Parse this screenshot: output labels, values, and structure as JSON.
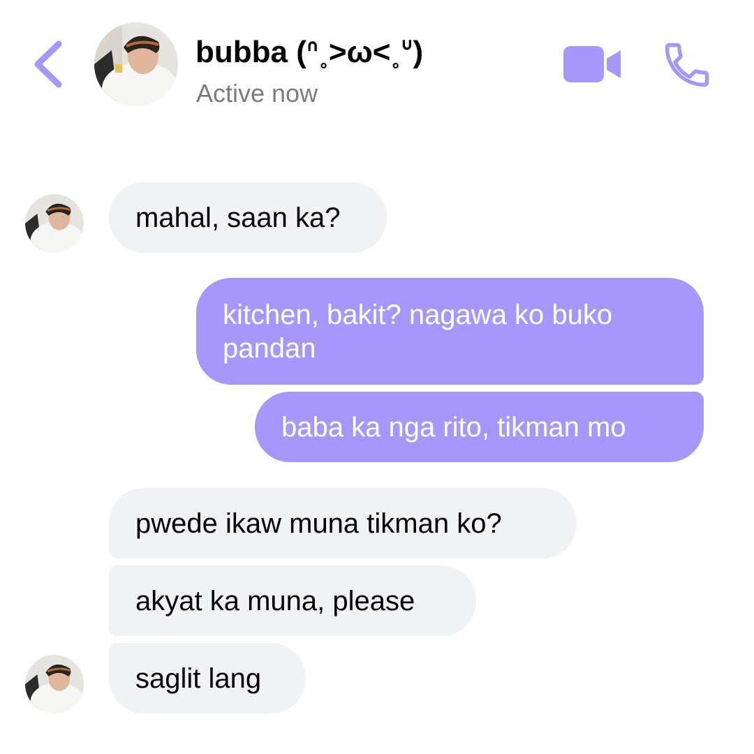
{
  "theme": {
    "accent": "#a797fd",
    "incoming_bubble": "#f1f2f6",
    "outgoing_bubble": "#a797fd",
    "status_gray": "#7a7a80"
  },
  "header": {
    "back_icon": "chevron-left-icon",
    "contact_name": "bubba (ᐢ˳>ω<˳ᐡ)",
    "status": "Active now",
    "video_icon": "video-camera-icon",
    "call_icon": "phone-icon"
  },
  "messages": [
    {
      "from": "contact",
      "text": "mahal, saan ka?"
    },
    {
      "from": "me",
      "text": "kitchen, bakit? nagawa ko buko pandan"
    },
    {
      "from": "me",
      "text": "baba ka nga rito, tikman mo"
    },
    {
      "from": "contact",
      "text": "pwede ikaw muna tikman ko?"
    },
    {
      "from": "contact",
      "text": "akyat ka muna, please"
    },
    {
      "from": "contact",
      "text": "saglit lang"
    }
  ]
}
